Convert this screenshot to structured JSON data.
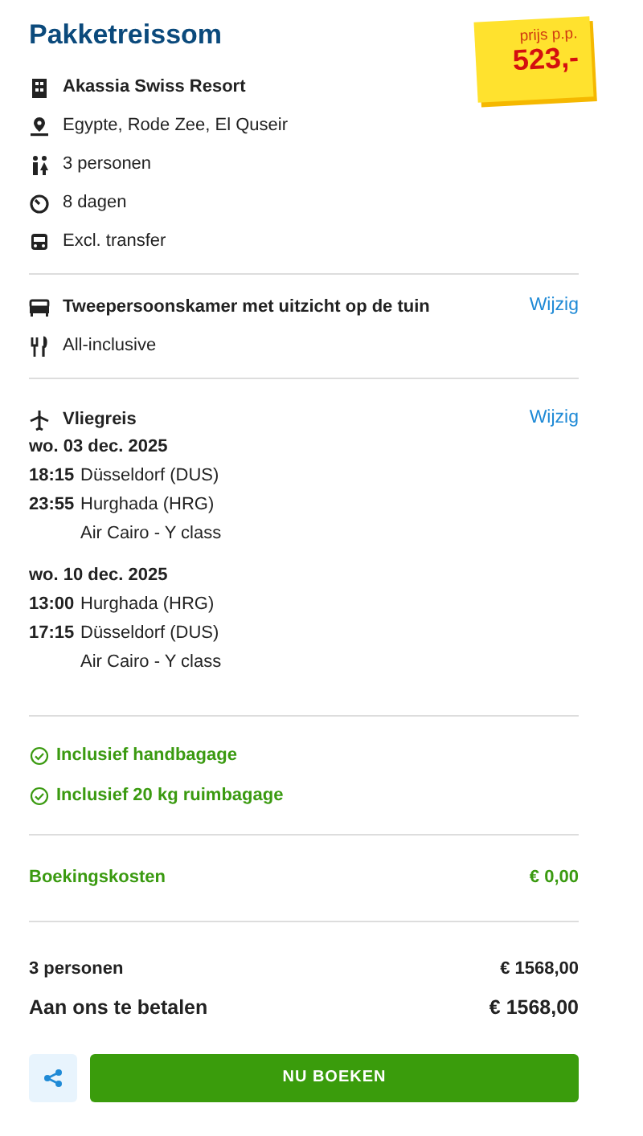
{
  "title": "Pakketreissom",
  "price_tag": {
    "label": "prijs p.p.",
    "amount": "523,-"
  },
  "details": [
    {
      "kind": "hotel",
      "text": "Akassia Swiss Resort",
      "bold": true
    },
    {
      "kind": "location",
      "text": "Egypte, Rode Zee, El Quseir",
      "bold": false
    },
    {
      "kind": "persons",
      "text": "3 personen",
      "bold": false
    },
    {
      "kind": "duration",
      "text": "8 dagen",
      "bold": false
    },
    {
      "kind": "transfer",
      "text": "Excl. transfer",
      "bold": false
    }
  ],
  "room": {
    "name": "Tweepersoonskamer met uitzicht op de tuin",
    "change": "Wijzig",
    "board": "All-inclusive"
  },
  "flight": {
    "title": "Vliegreis",
    "change": "Wijzig",
    "legs": [
      {
        "date": "wo. 03 dec. 2025",
        "segments": [
          {
            "time": "18:15",
            "place": "Düsseldorf (DUS)"
          },
          {
            "time": "23:55",
            "place": "Hurghada (HRG)"
          }
        ],
        "carrier": "Air Cairo - Y class"
      },
      {
        "date": "wo. 10 dec. 2025",
        "segments": [
          {
            "time": "13:00",
            "place": "Hurghada (HRG)"
          },
          {
            "time": "17:15",
            "place": "Düsseldorf (DUS)"
          }
        ],
        "carrier": "Air Cairo - Y class"
      }
    ]
  },
  "baggage": [
    "Inclusief handbagage",
    "Inclusief 20 kg ruimbagage"
  ],
  "booking_costs": {
    "label": "Boekingskosten",
    "value": "€ 0,00"
  },
  "totals": [
    {
      "label": "3 personen",
      "value": "€ 1568,00"
    },
    {
      "label": "Aan ons te betalen",
      "value": "€ 1568,00"
    }
  ],
  "book_button": "NU BOEKEN"
}
